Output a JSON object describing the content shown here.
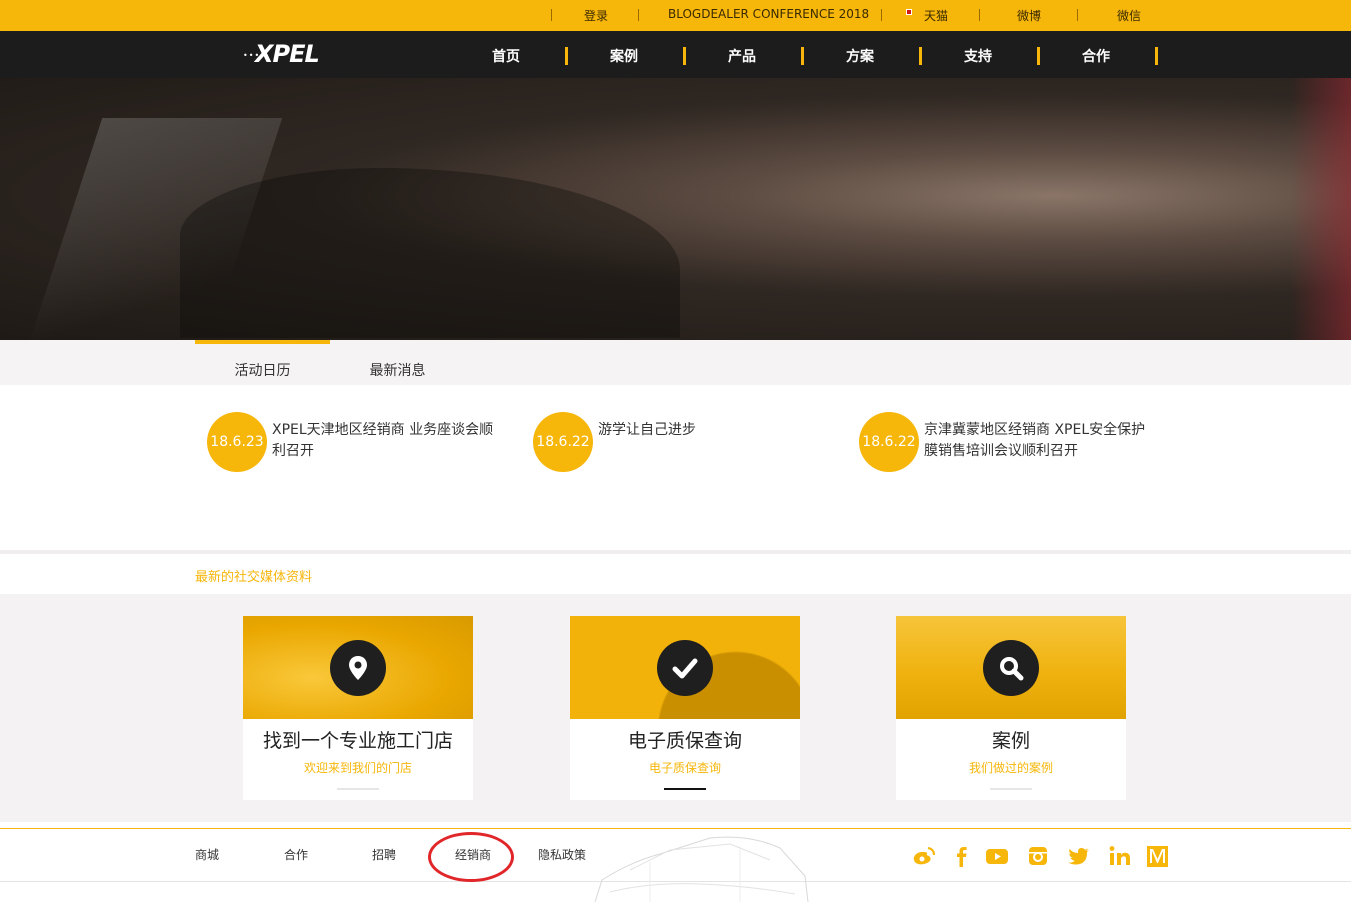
{
  "topbar": {
    "login": "登录",
    "conference": "BLOGDEALER CONFERENCE 2018",
    "tmall": "天猫",
    "weibo": "微博",
    "wechat": "微信"
  },
  "brand": {
    "logo_text": "XPEL"
  },
  "nav": {
    "items": [
      {
        "label": "首页"
      },
      {
        "label": "案例"
      },
      {
        "label": "产品"
      },
      {
        "label": "方案"
      },
      {
        "label": "支持"
      },
      {
        "label": "合作"
      }
    ]
  },
  "tabs": [
    {
      "label": "活动日历",
      "active": true
    },
    {
      "label": "最新消息",
      "active": false
    }
  ],
  "news": [
    {
      "date": "18.6.23",
      "title": "XPEL天津地区经销商 业务座谈会顺利召开"
    },
    {
      "date": "18.6.22",
      "title": "游学让自己进步"
    },
    {
      "date": "18.6.22",
      "title": "京津冀蒙地区经销商 XPEL安全保护膜销售培训会议顺利召开"
    }
  ],
  "social_title": "最新的社交媒体资料",
  "cards": [
    {
      "icon": "map-pin-icon",
      "title": "找到一个专业施工门店",
      "subtitle": "欢迎来到我们的门店"
    },
    {
      "icon": "checkmark-icon",
      "title": "电子质保查询",
      "subtitle": "电子质保查询"
    },
    {
      "icon": "search-icon",
      "title": "案例",
      "subtitle": "我们做过的案例"
    }
  ],
  "footer": {
    "links": [
      {
        "label": "商城"
      },
      {
        "label": "合作"
      },
      {
        "label": "招聘"
      },
      {
        "label": "经销商"
      },
      {
        "label": "隐私政策"
      }
    ],
    "social_icons": [
      "weibo-icon",
      "facebook-icon",
      "youtube-icon",
      "instagram-icon",
      "twitter-icon",
      "linkedin-icon",
      "medium-icon"
    ]
  },
  "colors": {
    "accent": "#f6b60a",
    "nav_bg": "#1c1c1c",
    "annotation": "#e1262a"
  }
}
